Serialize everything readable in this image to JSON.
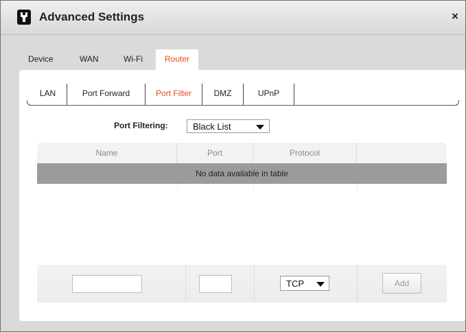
{
  "window": {
    "title": "Advanced Settings",
    "close_label": "×"
  },
  "top_tabs": [
    "Device",
    "WAN",
    "Wi-Fi",
    "Router"
  ],
  "active_top_tab": "Router",
  "sub_tabs": [
    "LAN",
    "Port Forward",
    "Port Filter",
    "DMZ",
    "UPnP"
  ],
  "active_sub_tab": "Port Filter",
  "port_filtering": {
    "label": "Port Filtering:",
    "value": "Black List"
  },
  "table": {
    "columns": [
      "Name",
      "Port",
      "Protocol",
      ""
    ],
    "empty_message": "No data available in table"
  },
  "add_row": {
    "name_value": "",
    "port_value": "",
    "protocol_value": "TCP",
    "add_label": "Add"
  },
  "colors": {
    "accent": "#e8491c",
    "empty_row": "#9b9b9b"
  }
}
